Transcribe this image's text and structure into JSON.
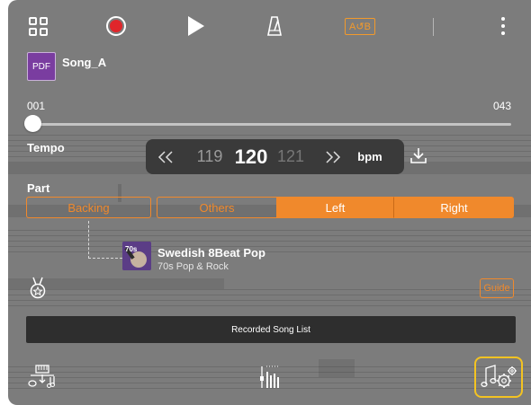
{
  "toolbar": {
    "menu_icon": "grid-menu-icon",
    "record_icon": "record-icon",
    "play_icon": "play-icon",
    "metronome_icon": "metronome-icon",
    "ab_repeat_label": "A↺B",
    "more_icon": "more-vertical-icon",
    "record_color": "#e0262b",
    "accent_color": "#f0892c"
  },
  "song": {
    "icon_label": "PDF",
    "title": "Song_A"
  },
  "position": {
    "start": "001",
    "end": "043",
    "progress": 0
  },
  "tempo": {
    "label": "Tempo",
    "prev": "119",
    "current": "120",
    "next": "121",
    "unit": "bpm",
    "rewind_icon": "rewind-icon",
    "fast_forward_icon": "fast-forward-icon",
    "download_icon": "download-icon"
  },
  "part": {
    "label": "Part",
    "tabs": [
      {
        "label": "Backing",
        "active": false
      },
      {
        "label": "Others",
        "active": false
      },
      {
        "label": "Left",
        "active": true
      },
      {
        "label": "Right",
        "active": true
      }
    ]
  },
  "style": {
    "name": "Swedish 8Beat Pop",
    "category": "70s Pop & Rock",
    "thumb_text": "70s"
  },
  "guide_label": "Guide",
  "recorded_song_list_label": "Recorded Song List",
  "bottom": {
    "score_icon": "score-transfer-icon",
    "mixer_icon": "mixer-icon",
    "settings_icon": "music-settings-icon",
    "highlight_color": "#f3c322"
  }
}
